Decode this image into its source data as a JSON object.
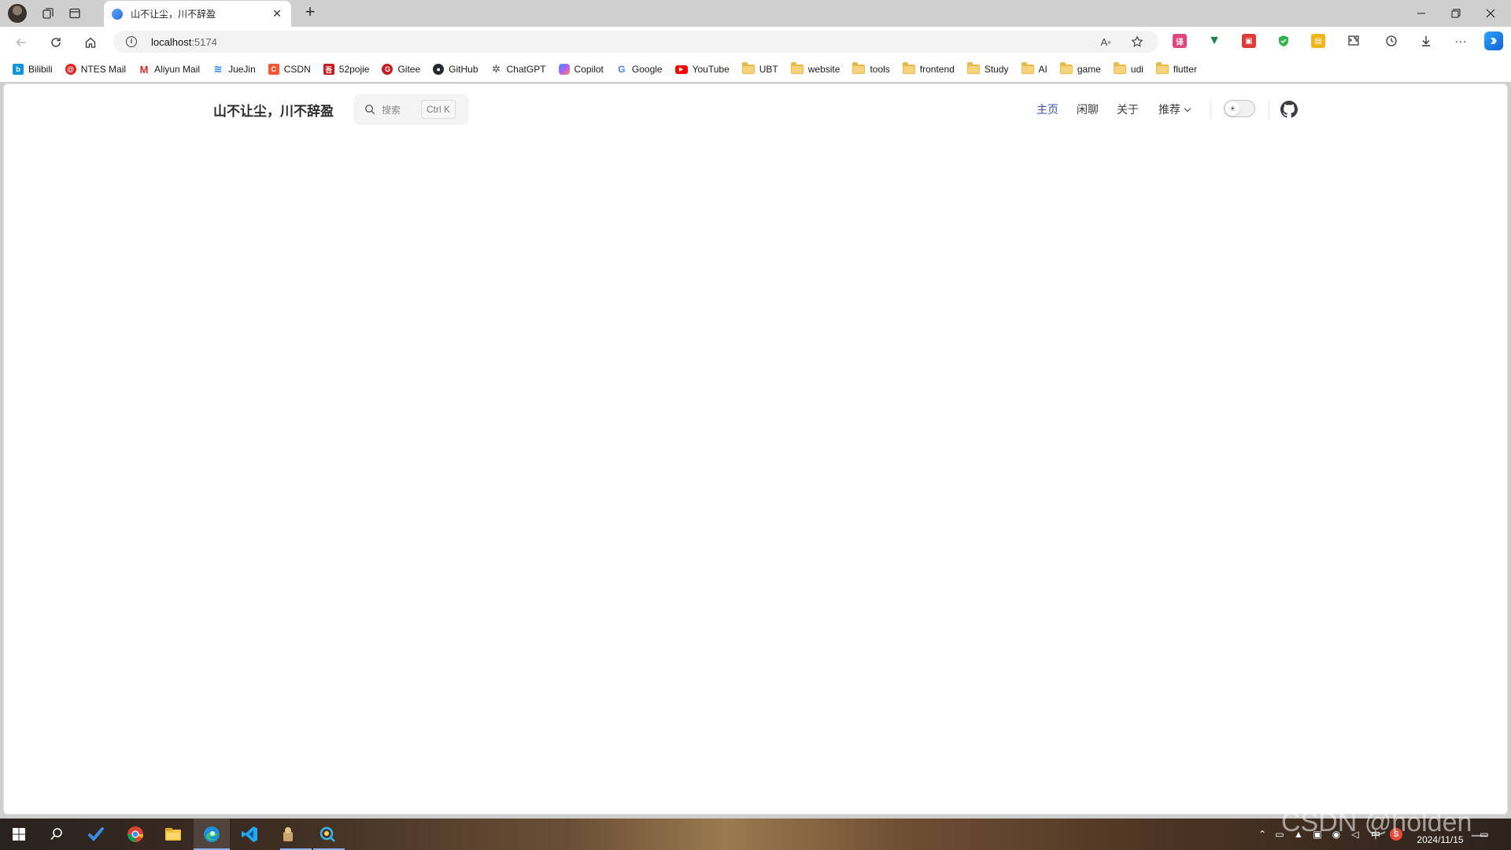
{
  "browser": {
    "tab": {
      "title": "山不让尘，川不辞盈"
    },
    "address": {
      "host": "localhost",
      "port": ":5174"
    },
    "bookmarks": [
      {
        "label": "Bilibili",
        "icon": "bilibili-icon",
        "color": "#1296db",
        "glyph": "b"
      },
      {
        "label": "NTES Mail",
        "icon": "ntes-mail-icon",
        "color": "#e32323",
        "glyph": "@"
      },
      {
        "label": "Aliyun Mail",
        "icon": "aliyun-mail-icon",
        "color": "#d52b2b",
        "glyph": "M"
      },
      {
        "label": "JueJin",
        "icon": "juejin-icon",
        "color": "#1e80ff",
        "glyph": "≋"
      },
      {
        "label": "CSDN",
        "icon": "csdn-icon",
        "color": "#fc5531",
        "glyph": "C"
      },
      {
        "label": "52pojie",
        "icon": "52pojie-icon",
        "color": "#c81e1e",
        "glyph": "吾"
      },
      {
        "label": "Gitee",
        "icon": "gitee-icon",
        "color": "#c71d23",
        "glyph": "G"
      },
      {
        "label": "GitHub",
        "icon": "github-icon",
        "color": "#24292f",
        "glyph": "●"
      },
      {
        "label": "ChatGPT",
        "icon": "chatgpt-icon",
        "color": "#444444",
        "glyph": "✲"
      },
      {
        "label": "Copilot",
        "icon": "copilot-icon",
        "color": "#7b5cff",
        "glyph": "◆"
      },
      {
        "label": "Google",
        "icon": "google-icon",
        "color": "#4285f4",
        "glyph": "G"
      },
      {
        "label": "YouTube",
        "icon": "youtube-icon",
        "color": "#ff0000",
        "glyph": "▶"
      }
    ],
    "folders": [
      "UBT",
      "website",
      "tools",
      "frontend",
      "Study",
      "AI",
      "game",
      "udi",
      "flutter"
    ]
  },
  "site": {
    "title": "山不让尘，川不辞盈",
    "search": {
      "placeholder": "搜索",
      "shortcut": "Ctrl K"
    },
    "nav": [
      {
        "label": "主页",
        "active": true
      },
      {
        "label": "闲聊",
        "active": false
      },
      {
        "label": "关于",
        "active": false
      },
      {
        "label": "推荐",
        "active": false,
        "dropdown": true
      }
    ],
    "accent_color": "#3451b2"
  },
  "taskbar": {
    "date": "2024/11/15",
    "ime": "中",
    "watermark": "CSDN @holden_"
  }
}
